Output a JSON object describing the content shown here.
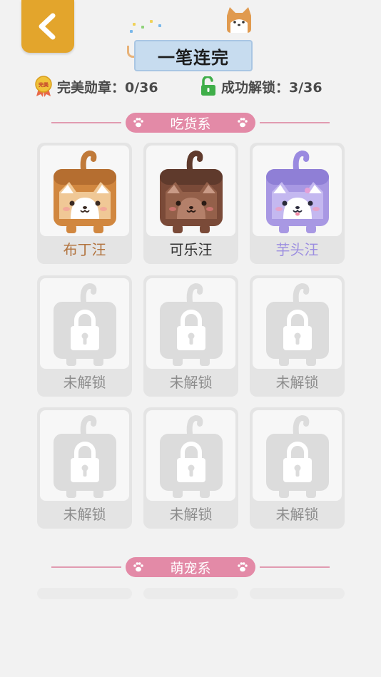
{
  "header": {
    "back_icon": "chevron-left-icon",
    "title": "一笔连完",
    "accent_color": "#e3a52c"
  },
  "stats": {
    "medals": "完美勋章：0/36",
    "unlocked": "成功解锁：3/36",
    "medal_icon": "medal-icon",
    "unlock_icon": "unlock-icon"
  },
  "sections": [
    {
      "title": "吃货系",
      "items": [
        {
          "name": "布丁汪",
          "state": "unlocked",
          "color": "#d1873f"
        },
        {
          "name": "可乐汪",
          "state": "unlocked",
          "color": "#7a4a38"
        },
        {
          "name": "芋头汪",
          "state": "unlocked",
          "color": "#a898e3"
        },
        {
          "name": "未解锁",
          "state": "locked"
        },
        {
          "name": "未解锁",
          "state": "locked"
        },
        {
          "name": "未解锁",
          "state": "locked"
        },
        {
          "name": "未解锁",
          "state": "locked"
        },
        {
          "name": "未解锁",
          "state": "locked"
        },
        {
          "name": "未解锁",
          "state": "locked"
        }
      ]
    },
    {
      "title": "萌宠系",
      "items": []
    }
  ]
}
